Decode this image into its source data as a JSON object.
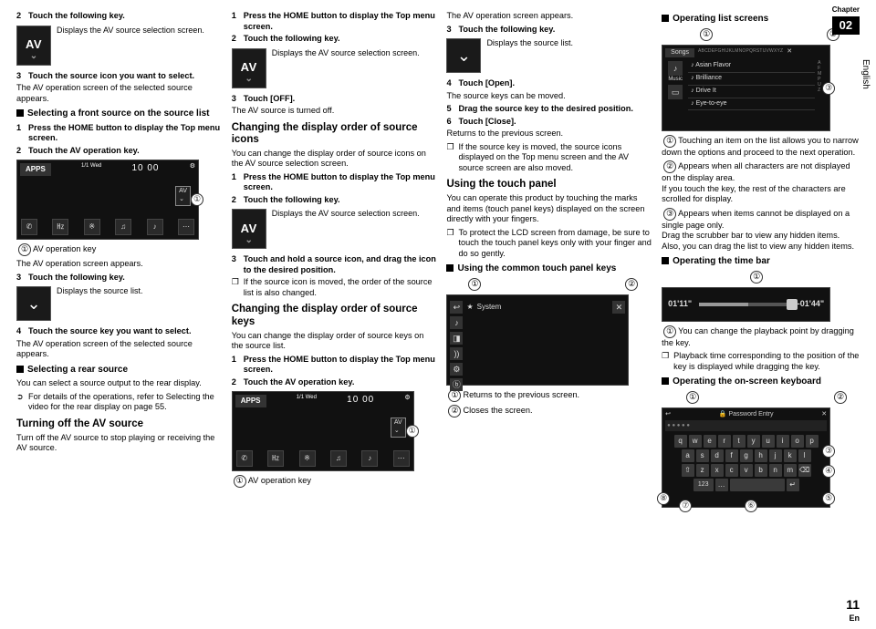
{
  "chapter": {
    "label": "Chapter",
    "number": "02"
  },
  "side_language": "English",
  "footer": {
    "page": "11",
    "lang": "En"
  },
  "av_tile": {
    "label": "AV",
    "desc": "Displays the AV source selection screen."
  },
  "src_tile": {
    "desc": "Displays the source list."
  },
  "col1": {
    "step2": "Touch the following key.",
    "step3": "Touch the source icon you want to select.",
    "note_sel": "The AV operation screen of the selected source appears.",
    "h_front": "Selecting a front source on the source list",
    "f1": "Press the HOME button to display the Top menu screen.",
    "f2": "Touch the AV operation key.",
    "apps_label": "APPS",
    "apps_time": "10 00",
    "apps_date": "1/1\nWed",
    "avkey_label": "AV operation key",
    "avkey_note": "The AV operation screen appears.",
    "f3": "Touch the following key.",
    "f4": "Touch the source key you want to select.",
    "h_rear": "Selecting a rear source",
    "rear_txt": "You can select a source output to the rear display.",
    "rear_xref": "For details of the operations, refer to Selecting the video for the rear display on page 55.",
    "h_turnoff": "Turning off the AV source",
    "turnoff_txt": "Turn off the AV source to stop playing or receiving the AV source."
  },
  "col2": {
    "s1": "Press the HOME button to display the Top menu screen.",
    "s2": "Touch the following key.",
    "s3": "Touch [OFF].",
    "off_note": "The AV source is turned off.",
    "h_order_icons": "Changing the display order of source icons",
    "order_icons_txt": "You can change the display order of source icons on the AV source selection screen.",
    "oi1": "Press the HOME button to display the Top menu screen.",
    "oi2": "Touch the following key.",
    "oi3": "Touch and hold a source icon, and drag the icon to the desired position.",
    "oi_note": "If the source icon is moved, the order of the source list is also changed.",
    "h_order_keys": "Changing the display order of source keys",
    "order_keys_txt": "You can change the display order of source keys on the source list.",
    "ok1": "Press the HOME button to display the Top menu screen.",
    "ok2": "Touch the AV operation key.",
    "avkey_cap": "AV operation key"
  },
  "col3": {
    "top_note": "The AV operation screen appears.",
    "s3": "Touch the following key.",
    "s4": "Touch [Open].",
    "open_note": "The source keys can be moved.",
    "s5": "Drag the source key to the desired position.",
    "s6": "Touch [Close].",
    "close_note": "Returns to the previous screen.",
    "bullet_move": "If the source key is moved, the source icons displayed on the Top menu screen and the AV source screen are also moved.",
    "h_touch": "Using the touch panel",
    "touch_txt": "You can operate this product by touching the marks and items (touch panel keys) displayed on the screen directly with your fingers.",
    "touch_note": "To protect the LCD screen from damage, be sure to touch the touch panel keys only with your finger and do so gently.",
    "h_common": "Using the common touch panel keys",
    "system_label": "System",
    "ret_label": "Returns to the previous screen.",
    "close_label": "Closes the screen."
  },
  "col4": {
    "h_list": "Operating list screens",
    "songs_hdr": "Songs",
    "alpha": "ABCDEFGHIJKLMNOPQRSTUVWXYZ",
    "song1": "Asian Flavor",
    "song2": "Brilliance",
    "song3": "Drive It",
    "song4": "Eye-to-eye",
    "list1": "Touching an item on the list allows you to narrow down the options and proceed to the next operation.",
    "list2": "Appears when all characters are not displayed on the display area.\nIf you touch the key, the rest of the characters are scrolled for display.",
    "list3": "Appears when items cannot be displayed on a single page only.\nDrag the scrubber bar to view any hidden items.\nAlso, you can drag the list to view any hidden items.",
    "h_time": "Operating the time bar",
    "time_l": "01'11\"",
    "time_r": "-01'44\"",
    "time1": "You can change the playback point by dragging the key.",
    "time_note": "Playback time corresponding to the position of the key is displayed while dragging the key.",
    "h_kbd": "Operating the on-screen keyboard",
    "kbd_title": "Password Entry",
    "keys_r1": [
      "q",
      "w",
      "e",
      "r",
      "t",
      "y",
      "u",
      "i",
      "o",
      "p"
    ],
    "keys_r2": [
      "a",
      "s",
      "d",
      "f",
      "g",
      "h",
      "j",
      "k",
      "l"
    ],
    "keys_r3": [
      "⇧",
      "z",
      "x",
      "c",
      "v",
      "b",
      "n",
      "m",
      "⌫"
    ],
    "keys_r4": [
      "123",
      "…",
      " ",
      "↵"
    ]
  }
}
